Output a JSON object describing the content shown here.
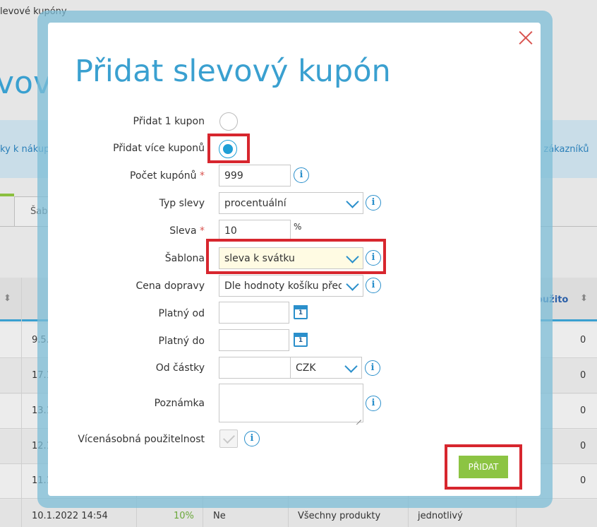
{
  "background": {
    "breadcrumb": "levové kupóny",
    "page_title": "vové",
    "bar_left_link": "ky k nákupů",
    "bar_right_link": "d zákazníků",
    "tab_label": "Šab",
    "column_used": "oužito",
    "sort_glyph": "⬍",
    "rows": [
      {
        "date": "9.5.",
        "used": "0"
      },
      {
        "date": "17.1",
        "used": "0"
      },
      {
        "date": "13.1",
        "used": "0"
      },
      {
        "date": "12.1",
        "used": "0"
      },
      {
        "date": "11.1",
        "used": "0"
      }
    ],
    "last_row": {
      "date": "10.1.2022 14:54",
      "pct": "10%",
      "multi": "Ne",
      "products": "Všechny produkty",
      "type": "jednotlivý"
    }
  },
  "modal": {
    "title": "Přidat slevový kupón",
    "close_icon": "close-icon",
    "add_one_label": "Přidat 1 kupon",
    "add_multi_label": "Přidat více kuponů",
    "add_multi_selected": true,
    "count_label": "Počet kupónů",
    "count_value": "999",
    "discount_type_label": "Typ slevy",
    "discount_type_value": "procentuální",
    "discount_label": "Sleva",
    "discount_value": "10",
    "discount_unit": "%",
    "template_label": "Šablona",
    "template_value": "sleva k svátku",
    "shipping_label": "Cena dopravy",
    "shipping_value": "Dle hodnoty košíku před s",
    "valid_from_label": "Platný od",
    "valid_from_value": "",
    "valid_to_label": "Platný do",
    "valid_to_value": "",
    "calendar_day": "1",
    "min_amount_label": "Od částky",
    "min_amount_value": "",
    "currency_value": "CZK",
    "note_label": "Poznámka",
    "multi_use_label": "Vícenásobná použitelnost",
    "required_mark": "*",
    "info_glyph": "i",
    "submit_label": "PŘIDAT"
  },
  "colors": {
    "accent": "#3aa0d0",
    "highlight_box": "#d7262e",
    "submit": "#8cc443",
    "required": "#d9534f"
  }
}
